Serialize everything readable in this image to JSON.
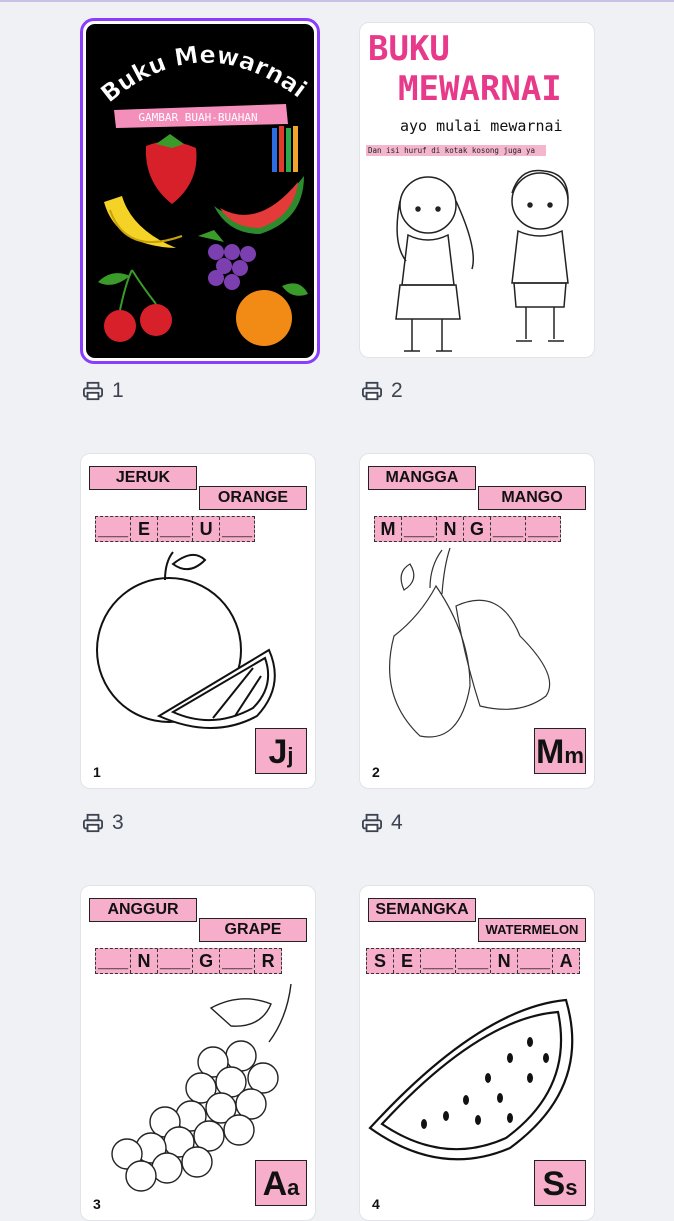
{
  "pages": [
    {
      "num": "1",
      "cover_title": "Buku Mewarnai",
      "cover_subtitle": "GAMBAR BUAH-BUAHAN"
    },
    {
      "num": "2",
      "title_line1": "BUKU",
      "title_line2": "MEWARNAI",
      "tagline": "ayo mulai mewarnai",
      "instruction": "Dan isi huruf di kotak kosong juga ya"
    },
    {
      "num": "3",
      "word_id": "JERUK",
      "word_en": "ORANGE",
      "blanks": [
        "___",
        "E",
        "___",
        "U",
        "___"
      ],
      "letter_big": "J",
      "letter_small": "j",
      "card_no": "1"
    },
    {
      "num": "4",
      "word_id": "MANGGA",
      "word_en": "MANGO",
      "blanks": [
        "M",
        "___",
        "N",
        "G",
        "___",
        "___"
      ],
      "letter_big": "M",
      "letter_small": "m",
      "card_no": "2"
    },
    {
      "num": "",
      "word_id": "ANGGUR",
      "word_en": "GRAPE",
      "blanks": [
        "___",
        "N",
        "___",
        "G",
        "___",
        "R"
      ],
      "letter_big": "A",
      "letter_small": "a",
      "card_no": "3"
    },
    {
      "num": "",
      "word_id": "SEMANGKA",
      "word_en": "WATERMELON",
      "blanks": [
        "S",
        "E",
        "___",
        "___",
        "N",
        "___",
        "A"
      ],
      "letter_big": "S",
      "letter_small": "s",
      "card_no": "4"
    }
  ],
  "icons": {
    "print": "printer-icon"
  }
}
